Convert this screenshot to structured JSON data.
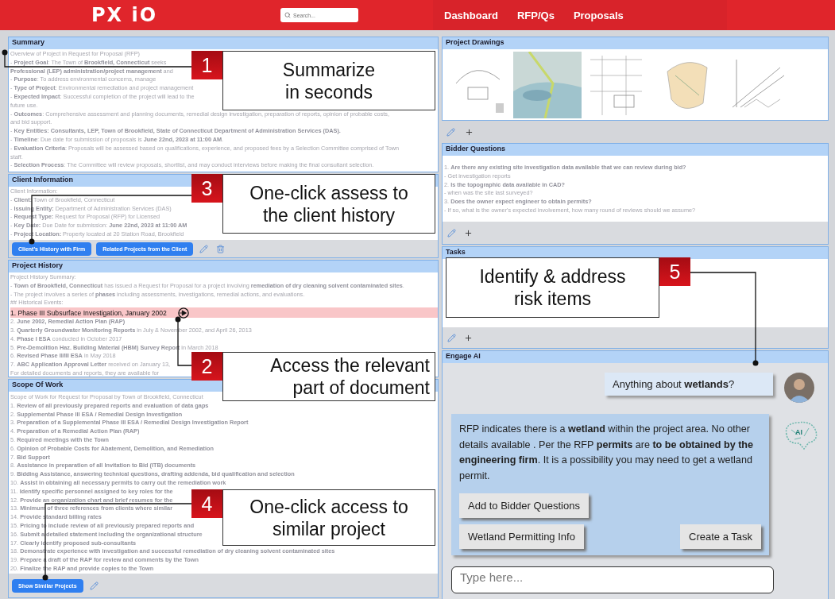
{
  "header": {
    "logo": "PX iO",
    "search": {
      "placeholder": "Search..."
    },
    "nav": [
      "Dashboard",
      "RFP/Qs",
      "Proposals"
    ]
  },
  "summary": {
    "title": "Summary",
    "lines": [
      "Overview of Project in Request for Proposal (RFP)",
      "- **Project Goal**: The Town of **Brookfield, Connecticut** seeks",
      "**Professional (LEP) administration/project management** and",
      "- **Purpose**: To address environmental concerns, manage",
      "- **Type of Project**: Environmental remediation and project management",
      "- **Expected Impact**: Successful completion of the project will lead to the",
      "future use.",
      "- **Outcomes**: Comprehensive assessment and planning documents, remedial design investigation, preparation of reports, opinion of probable costs,",
      "and bid support.",
      "- **Key Entities: Consultants, LEP, Town of Brookfield, State of Connecticut Department of Administration Services (DAS).**",
      "- **Timeline**: Due date for submission of proposals is **June 22nd, 2023 at 11:00 AM**.",
      "- **Evaluation Criteria**: Proposals will be assessed based on qualifications, experience, and proposed fees by a Selection Committee comprised of Town",
      "staff.",
      "- **Selection Process**: The Committee will review proposals, shortlist, and may conduct interviews before making the final consultant selection."
    ]
  },
  "client": {
    "title": "Client Information",
    "lines": [
      "Client Information:",
      "- **Client:** Town of Brookfield, Connecticut",
      "- **Issuing Entity:** Department of Administration Services (DAS)",
      "- **Request Type:** Request for Proposal (RFP) for Licensed",
      "- **Key Date:** Due Date for submission: **June 22nd, 2023 at 11:00 AM**",
      "- **Project Location:** Property located at 20 Station Road, Brookfield"
    ],
    "buttons": [
      "Client's History with Firm",
      "Related Projects from the Client"
    ],
    "tools": [
      {
        "kind": "edit"
      },
      {
        "kind": "delete"
      }
    ]
  },
  "history": {
    "title": "Project History",
    "intro": [
      "Project History Summary:",
      "- **Town of Brookfield, Connecticut** has issued a Request for Proposal for a project involving **remediation of dry cleaning solvent contaminated sites**.",
      "- The project involves a series of **phases** including assessments, investigations, remedial actions, and evaluations.",
      "## Historical Events:"
    ],
    "events": [
      {
        "text": "1. Phase III Subsurface Investigation, January 2002",
        "highlighted": true
      },
      {
        "text": "2. **June 2002, Remedial Action Plan (RAP)**",
        "highlighted": false
      },
      {
        "text": "3. **Quarterly Groundwater Monitoring Reports** in July & November 2002, and April 26, 2013",
        "highlighted": false
      },
      {
        "text": "4. **Phase I ESA** conducted in October 2017",
        "highlighted": false
      },
      {
        "text": "5. **Pre-Demolition Haz. Building Material (HBM) Survey Report** in March 2018",
        "highlighted": false
      },
      {
        "text": "6. **Revised Phase II/III ESA** in May 2018",
        "highlighted": false
      },
      {
        "text": "7. **ABC Application Approval Letter** received on January 13,",
        "highlighted": false
      }
    ],
    "outro": [
      "For detailed documents and reports, they are available for"
    ]
  },
  "scope": {
    "title": "Scope Of Work",
    "lines": [
      "Scope of Work for Request for Proposal by Town of Brookfield, Connecticut",
      "1. **Review of all previously prepared reports and evaluation of data gaps**",
      "2. **Supplemental Phase III ESA / Remedial Design Investigation**",
      "3. **Preparation of a Supplemental Phase III ESA / Remedial Design Investigation Report**",
      "4. **Preparation of a Remedial Action Plan (RAP)**",
      "5. **Required meetings with the Town**",
      "6. **Opinion of Probable Costs for Abatement, Demolition, and Remediation**",
      "7. **Bid Support**",
      "8. **Assistance in preparation of all Invitation to Bid (ITB) documents**",
      "9. **Bidding Assistance, answering technical questions, drafting addenda, bid qualification and selection**",
      "10. **Assist in obtaining all necessary permits to carry out the remediation work**",
      "11. **Identify specific personnel assigned to key roles for the**",
      "12. **Provide an organization chart and brief resumes for the**",
      "13. **Minimum of three references from clients where similar**",
      "14. **Provide standard billing rates**",
      "15. **Pricing to include review of all previously prepared reports and**",
      "16. **Submit a detailed statement including the organizational structure**",
      "17. **Clearly identify proposed sub-consultants**",
      "18. **Demonstrate experience with investigation and successful remediation of dry cleaning solvent contaminated sites**",
      "19. **Prepare a draft of the RAP for review and comments by the Town**",
      "20. **Finalize the RAP and provide copies to the Town**"
    ],
    "buttons": [
      "Show Similar Projects"
    ],
    "tools": [
      {
        "kind": "edit"
      }
    ]
  },
  "drawings": {
    "title": "Project Drawings",
    "tools": [
      {
        "kind": "edit"
      },
      {
        "kind": "add"
      }
    ]
  },
  "bidder_questions": {
    "title": "Bidder Questions",
    "lines": [
      "1. **Are there any existing site investigation data available that we can review during bid?**",
      "- Get investigation reports",
      "2. **Is the topographic data available in CAD?**",
      "- when was the site last surveyed?",
      "3. **Does the owner expect engineer to obtain permits?**",
      "- If so, what is the owner's expected involvement, how many round of reviews should we assume?"
    ],
    "tools": [
      {
        "kind": "edit"
      },
      {
        "kind": "add"
      }
    ]
  },
  "tasks": {
    "title": "Tasks",
    "tools": [
      {
        "kind": "edit"
      },
      {
        "kind": "add"
      }
    ]
  },
  "engage_ai": {
    "title": "Engage AI",
    "ai_badge": "AI",
    "messages": [
      {
        "kind": "user",
        "text": "Anything about **wetlands**?"
      },
      {
        "kind": "ai",
        "text": "RFP indicates there is a **wetland** within the project area. No other details available . Per the RFP  **permits** are **to be obtained by the engineering firm**. It is a possibility you may need to get a wetland permit.",
        "actions": [
          "Add to Bidder Questions",
          "Wetland Permitting Info",
          "Create a Task"
        ]
      }
    ],
    "input": {
      "placeholder": "Type here..."
    }
  },
  "callouts": [
    {
      "number": "1",
      "lines": [
        "Summarize",
        "in seconds"
      ]
    },
    {
      "number": "3",
      "lines": [
        "One-click assess to",
        "the client history"
      ]
    },
    {
      "number": "2",
      "lines": [
        "Access the relevant",
        "part of document"
      ]
    },
    {
      "number": "4",
      "lines": [
        "One-click access to",
        "similar project"
      ]
    },
    {
      "number": "5",
      "lines": [
        "Identify & address",
        "risk items"
      ]
    }
  ]
}
